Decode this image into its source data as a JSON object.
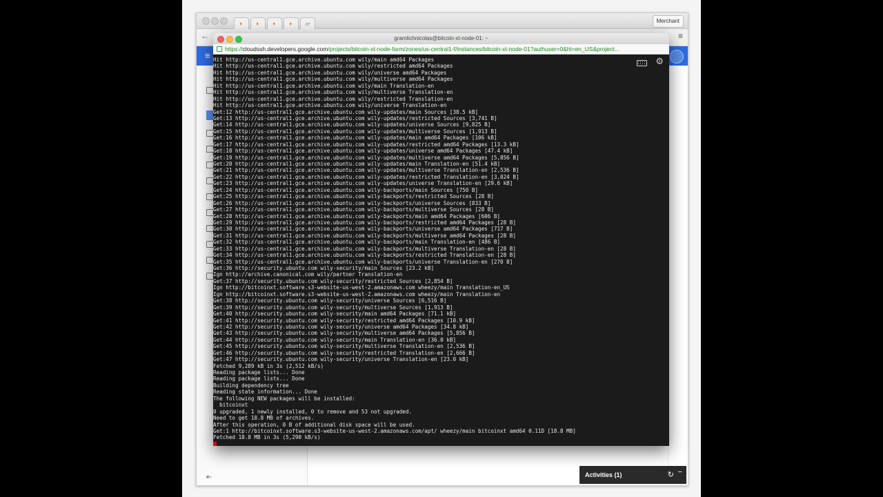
{
  "browser": {
    "tabs": [
      "",
      "",
      "",
      ""
    ],
    "merchant_button": "Merchant",
    "activities_label": "Activities (1)"
  },
  "ssh_window": {
    "title": "gramlichnicolas@bitcoin-xt-node-01: ~",
    "url_scheme": "https://",
    "url_host": "cloudssh.developers.google.com",
    "url_path": "/projects/bitcoin-xt-node-farm/zones/us-central1-f/instances/bitcoin-xt-node-01?authuser=0&hl=en_US&project..."
  },
  "terminal": {
    "lines": [
      "Hit http://us-central1.gce.archive.ubuntu.com wily/main amd64 Packages",
      "Hit http://us-central1.gce.archive.ubuntu.com wily/restricted amd64 Packages",
      "Hit http://us-central1.gce.archive.ubuntu.com wily/universe amd64 Packages",
      "Hit http://us-central1.gce.archive.ubuntu.com wily/multiverse amd64 Packages",
      "Hit http://us-central1.gce.archive.ubuntu.com wily/main Translation-en",
      "Hit http://us-central1.gce.archive.ubuntu.com wily/multiverse Translation-en",
      "Hit http://us-central1.gce.archive.ubuntu.com wily/restricted Translation-en",
      "Hit http://us-central1.gce.archive.ubuntu.com wily/universe Translation-en",
      "Get:12 http://us-central1.gce.archive.ubuntu.com wily-updates/main Sources [38.5 kB]",
      "Get:13 http://us-central1.gce.archive.ubuntu.com wily-updates/restricted Sources [3,741 B]",
      "Get:14 http://us-central1.gce.archive.ubuntu.com wily-updates/universe Sources [9,825 B]",
      "Get:15 http://us-central1.gce.archive.ubuntu.com wily-updates/multiverse Sources [1,913 B]",
      "Get:16 http://us-central1.gce.archive.ubuntu.com wily-updates/main amd64 Packages [106 kB]",
      "Get:17 http://us-central1.gce.archive.ubuntu.com wily-updates/restricted amd64 Packages [13.3 kB]",
      "Get:18 http://us-central1.gce.archive.ubuntu.com wily-updates/universe amd64 Packages [47.4 kB]",
      "Get:19 http://us-central1.gce.archive.ubuntu.com wily-updates/multiverse amd64 Packages [5,856 B]",
      "Get:20 http://us-central1.gce.archive.ubuntu.com wily-updates/main Translation-en [51.4 kB]",
      "Get:21 http://us-central1.gce.archive.ubuntu.com wily-updates/multiverse Translation-en [2,536 B]",
      "Get:22 http://us-central1.gce.archive.ubuntu.com wily-updates/restricted Translation-en [3,024 B]",
      "Get:23 http://us-central1.gce.archive.ubuntu.com wily-updates/universe Translation-en [29.6 kB]",
      "Get:24 http://us-central1.gce.archive.ubuntu.com wily-backports/main Sources [750 B]",
      "Get:25 http://us-central1.gce.archive.ubuntu.com wily-backports/restricted Sources [28 B]",
      "Get:26 http://us-central1.gce.archive.ubuntu.com wily-backports/universe Sources [833 B]",
      "Get:27 http://us-central1.gce.archive.ubuntu.com wily-backports/multiverse Sources [28 B]",
      "Get:28 http://us-central1.gce.archive.ubuntu.com wily-backports/main amd64 Packages [606 B]",
      "Get:29 http://us-central1.gce.archive.ubuntu.com wily-backports/restricted amd64 Packages [28 B]",
      "Get:30 http://us-central1.gce.archive.ubuntu.com wily-backports/universe amd64 Packages [717 B]",
      "Get:31 http://us-central1.gce.archive.ubuntu.com wily-backports/multiverse amd64 Packages [28 B]",
      "Get:32 http://us-central1.gce.archive.ubuntu.com wily-backports/main Translation-en [486 B]",
      "Get:33 http://us-central1.gce.archive.ubuntu.com wily-backports/multiverse Translation-en [28 B]",
      "Get:34 http://us-central1.gce.archive.ubuntu.com wily-backports/restricted Translation-en [28 B]",
      "Get:35 http://us-central1.gce.archive.ubuntu.com wily-backports/universe Translation-en [270 B]",
      "Get:36 http://security.ubuntu.com wily-security/main Sources [23.2 kB]",
      "Ign http://archive.canonical.com wily/partner Translation-en",
      "Get:37 http://security.ubuntu.com wily-security/restricted Sources [2,854 B]",
      "Ign http://bitcoinxt.software.s3-website-us-west-2.amazonaws.com wheezy/main Translation-en_US",
      "Ign http://bitcoinxt.software.s3-website-us-west-2.amazonaws.com wheezy/main Translation-en",
      "Get:38 http://security.ubuntu.com wily-security/universe Sources [6,516 B]",
      "Get:39 http://security.ubuntu.com wily-security/multiverse Sources [1,913 B]",
      "Get:40 http://security.ubuntu.com wily-security/main amd64 Packages [71.1 kB]",
      "Get:41 http://security.ubuntu.com wily-security/restricted amd64 Packages [10.9 kB]",
      "Get:42 http://security.ubuntu.com wily-security/universe amd64 Packages [34.8 kB]",
      "Get:43 http://security.ubuntu.com wily-security/multiverse amd64 Packages [5,856 B]",
      "Get:44 http://security.ubuntu.com wily-security/main Translation-en [36.0 kB]",
      "Get:45 http://security.ubuntu.com wily-security/multiverse Translation-en [2,536 B]",
      "Get:46 http://security.ubuntu.com wily-security/restricted Translation-en [2,666 B]",
      "Get:47 http://security.ubuntu.com wily-security/universe Translation-en [23.0 kB]",
      "Fetched 9,289 kB in 3s (2,512 kB/s)",
      "Reading package lists... Done",
      "Reading package lists... Done",
      "Building dependency tree",
      "Reading state information... Done",
      "The following NEW packages will be installed:",
      "  bitcoinxt",
      "0 upgraded, 1 newly installed, 0 to remove and 53 not upgraded.",
      "Need to get 18.8 MB of archives.",
      "After this operation, 0 B of additional disk space will be used.",
      "Get:1 http://bitcoinxt.software.s3-website-us-west-2.amazonaws.com/apt/ wheezy/main bitcoinxt amd64 0.11D [18.8 MB]",
      "Fetched 18.8 MB in 3s (5,290 kB/s)"
    ]
  },
  "colors": {
    "terminal_bg": "#1b1b1b",
    "terminal_fg": "#e8e8e8",
    "console_blue": "#2e6ce0",
    "cursor": "#d01010"
  }
}
